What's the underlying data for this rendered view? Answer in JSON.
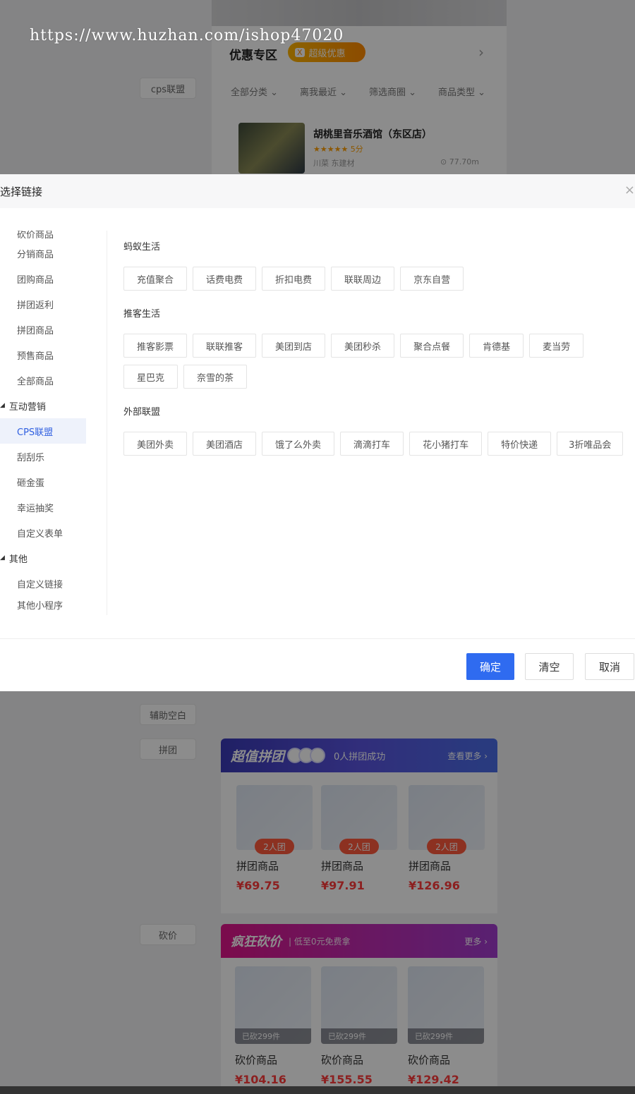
{
  "watermark": "https://www.huzhan.com/ishop47020",
  "background": {
    "side_buttons": [
      "cps联盟",
      "辅助空白",
      "拼团",
      "砍价"
    ],
    "promo_section": {
      "title": "优惠专区",
      "tag_badge": "X",
      "tag_text": "超级优惠",
      "filters": [
        "全部分类 ⌄",
        "离我最近 ⌄",
        "筛选商圈 ⌄",
        "商品类型 ⌄"
      ]
    },
    "store": {
      "name": "胡桃里音乐酒馆（东区店）",
      "rating": "★★★★★ 5分",
      "category": "川菜 东建材",
      "distance": "⊙ 77.70m"
    },
    "group_banner": {
      "title": "超值拼团",
      "subtitle": "0人拼团成功",
      "more": "查看更多 ›"
    },
    "group_products": [
      {
        "tag": "2人团",
        "name": "拼团商品",
        "price": "¥69.75"
      },
      {
        "tag": "2人团",
        "name": "拼团商品",
        "price": "¥97.91"
      },
      {
        "tag": "2人团",
        "name": "拼团商品",
        "price": "¥126.96"
      }
    ],
    "cut_banner": {
      "title": "疯狂砍价",
      "subtitle": "| 低至0元免费拿",
      "more": "更多 ›"
    },
    "cut_products": [
      {
        "sold": "已砍299件",
        "name": "砍价商品",
        "price": "¥104.16"
      },
      {
        "sold": "已砍299件",
        "name": "砍价商品",
        "price": "¥155.55"
      },
      {
        "sold": "已砍299件",
        "name": "砍价商品",
        "price": "¥129.42"
      }
    ]
  },
  "modal": {
    "title": "选择链接",
    "close": "×",
    "tree": {
      "top_cut": "砍价商品",
      "items_a": [
        "分销商品",
        "团购商品",
        "拼团返利",
        "拼团商品",
        "预售商品",
        "全部商品"
      ],
      "cat_marketing": "互动营销",
      "active": "CPS联盟",
      "items_b": [
        "刮刮乐",
        "砸金蛋",
        "幸运抽奖",
        "自定义表单"
      ],
      "cat_other": "其他",
      "items_c": [
        "自定义链接"
      ],
      "bottom_cut": "其他小程序"
    },
    "groups": [
      {
        "title": "蚂蚁生活",
        "chips": [
          "充值聚合",
          "话费电费",
          "折扣电费",
          "联联周边",
          "京东自营"
        ]
      },
      {
        "title": "推客生活",
        "chips": [
          "推客影票",
          "联联推客",
          "美团到店",
          "美团秒杀",
          "聚合点餐",
          "肯德基",
          "麦当劳",
          "星巴克",
          "奈雪的茶"
        ]
      },
      {
        "title": "外部联盟",
        "chips": [
          "美团外卖",
          "美团酒店",
          "饿了么外卖",
          "滴滴打车",
          "花小猪打车",
          "特价快递",
          "3折唯品会"
        ]
      }
    ],
    "buttons": {
      "confirm": "确定",
      "clear": "清空",
      "cancel": "取消"
    }
  }
}
